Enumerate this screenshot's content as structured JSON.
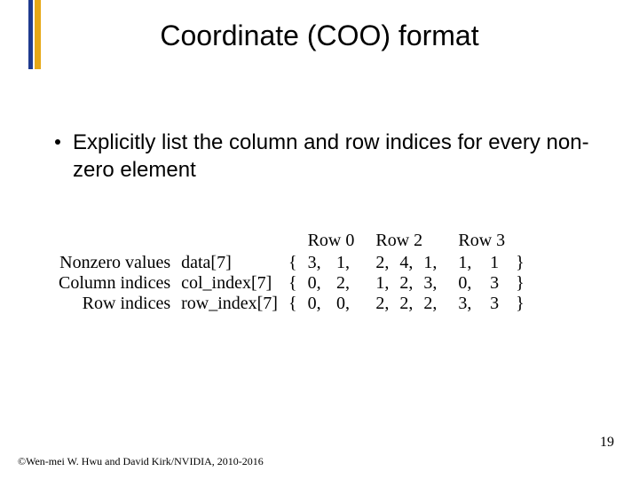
{
  "slide": {
    "title": "Coordinate (COO) format",
    "bullet": "Explicitly list the column and row indices for every non-zero element",
    "slide_number": "19",
    "copyright": "©Wen-mei W. Hwu and David Kirk/NVIDIA, 2010-2016"
  },
  "table": {
    "group_headers": [
      "Row 0",
      "Row 2",
      "Row 3"
    ],
    "rows": [
      {
        "label": "Nonzero values",
        "array": "data[7]",
        "open": "{",
        "g0": [
          "3,",
          "1,"
        ],
        "g1": [
          "2,",
          "4,",
          "1,"
        ],
        "g2": [
          "1,",
          "1"
        ],
        "close": "}"
      },
      {
        "label": "Column indices",
        "array": "col_index[7]",
        "open": "{",
        "g0": [
          "0,",
          "2,"
        ],
        "g1": [
          "1,",
          "2,",
          "3,"
        ],
        "g2": [
          "0,",
          "3"
        ],
        "close": "}"
      },
      {
        "label": "Row indices",
        "array": "row_index[7]",
        "open": "{",
        "g0": [
          "0,",
          "0,"
        ],
        "g1": [
          "2,",
          "2,",
          "2,"
        ],
        "g2": [
          "3,",
          "3"
        ],
        "close": "}"
      }
    ]
  }
}
